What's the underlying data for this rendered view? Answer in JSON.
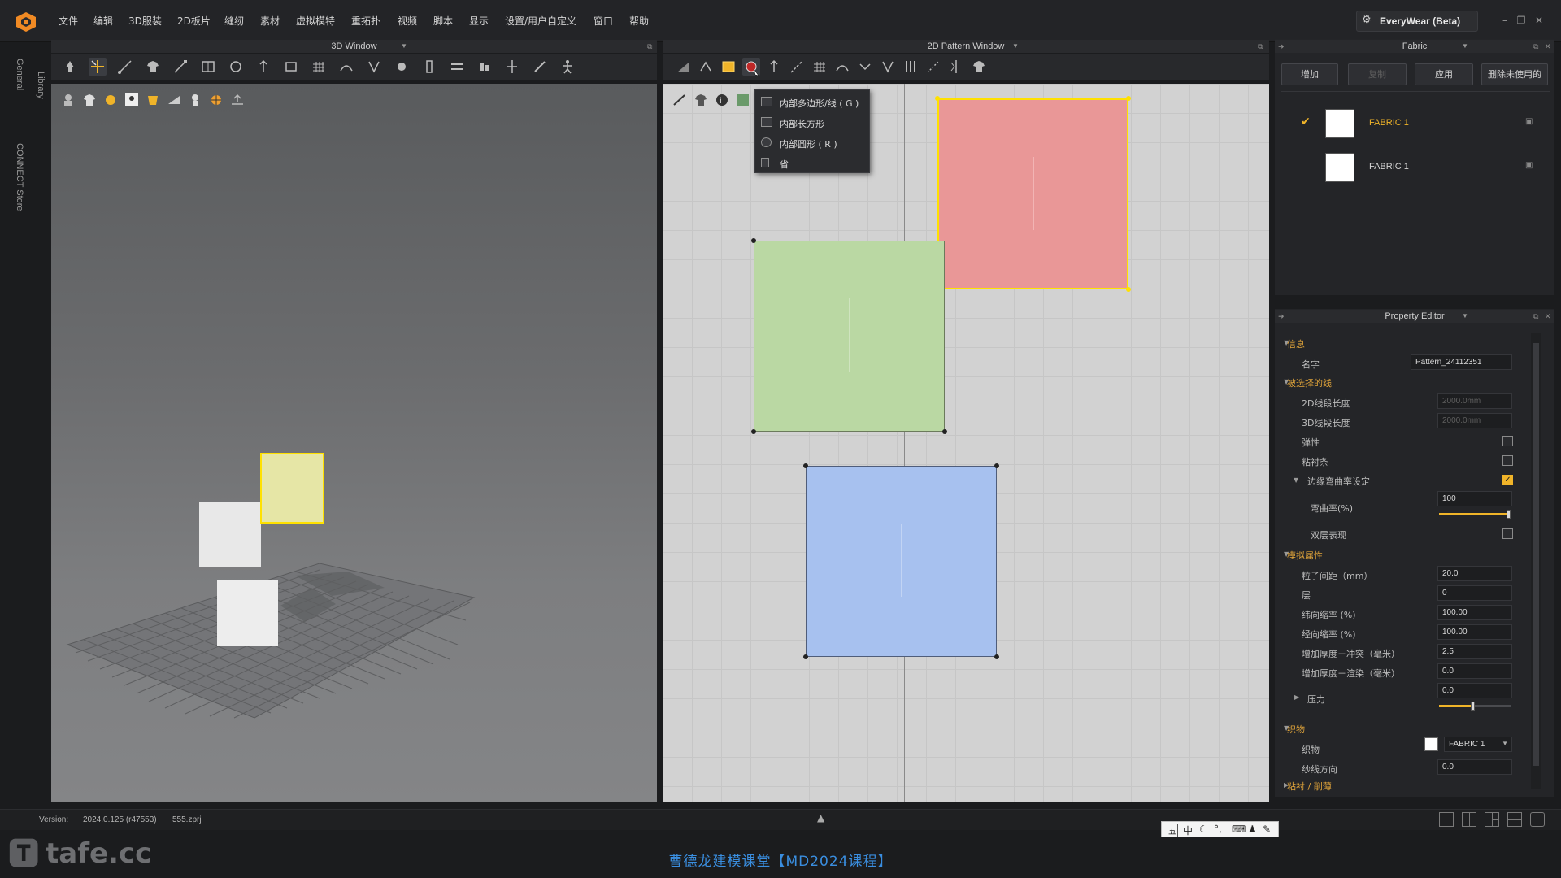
{
  "menu": {
    "items": [
      "文件",
      "编辑",
      "3D服装",
      "2D板片",
      "缝纫",
      "素材",
      "虚拟模特",
      "重拓扑",
      "视频",
      "脚本",
      "显示",
      "设置/用户自定义",
      "窗口",
      "帮助"
    ]
  },
  "edition": "EveryWear (Beta)",
  "side_tabs": {
    "library": "Library",
    "general": "General",
    "connect_store": "CONNECT Store"
  },
  "windows": {
    "w3d_title": "3D Window",
    "w2d_title": "2D Pattern Window",
    "fabric_title": "Fabric",
    "prop_title": "Property Editor"
  },
  "dropdown": {
    "items": [
      "内部多边形/线 ( G )",
      "内部长方形",
      "内部圆形 ( R )",
      "省"
    ]
  },
  "fabric": {
    "buttons": [
      "增加",
      "复制",
      "应用",
      "删除未使用的"
    ],
    "list": [
      {
        "name": "FABRIC 1",
        "selected": true
      },
      {
        "name": "FABRIC 1",
        "selected": false
      }
    ]
  },
  "props": {
    "sec_info": "信息",
    "name_label": "名字",
    "name_value": "Pattern_24112351",
    "sec_selected_line": "被选择的线",
    "len2d_label": "2D线段长度",
    "len2d_value": "2000.0mm",
    "len3d_label": "3D线段长度",
    "len3d_value": "2000.0mm",
    "elastic_label": "弹性",
    "tape_label": "粘衬条",
    "edge_curve_label": "边缘弯曲率设定",
    "curve_label": "弯曲率(%)",
    "curve_value": "100",
    "curve_level": 1.0,
    "double_label": "双层表现",
    "sec_sim": "模拟属性",
    "particle_label": "粒子间距（mm）",
    "particle_value": "20.0",
    "layer_label": "层",
    "layer_value": "0",
    "weft_label": "纬向缩率 (%)",
    "weft_value": "100.00",
    "warp_label": "经向缩率 (%)",
    "warp_value": "100.00",
    "thick_collide_label": "增加厚度－冲突（毫米）",
    "thick_collide_value": "2.5",
    "thick_render_label": "增加厚度－渲染（毫米）",
    "thick_render_value": "0.0",
    "pressure_label": "压力",
    "pressure_value": "0.0",
    "pressure_level": 0.5,
    "sec_fabric": "织物",
    "fabric_label": "织物",
    "fabric_value": "FABRIC 1",
    "grain_label": "纱线方向",
    "grain_value": "0.0",
    "sec_bond": "粘衬 / 削薄"
  },
  "status": {
    "version_label": "Version:",
    "version_value": "2024.0.125 (r47553)",
    "file": "555.zprj"
  },
  "ime": [
    "五",
    "中"
  ],
  "watermark": "tafe.cc",
  "caption": "曹德龙建模课堂【MD2024课程】",
  "colors": {
    "accent": "#f0b429",
    "pattern_red": "#e99797",
    "pattern_green": "#bad8a3",
    "pattern_blue": "#a7c1ef",
    "selection": "#ffe100",
    "caption": "#3a8ee0"
  },
  "icons": [
    "orange-cube-logo",
    "arrow-tool-icon",
    "rectangle-tool-icon",
    "circle-tool-icon",
    "t-shirt-icon"
  ]
}
